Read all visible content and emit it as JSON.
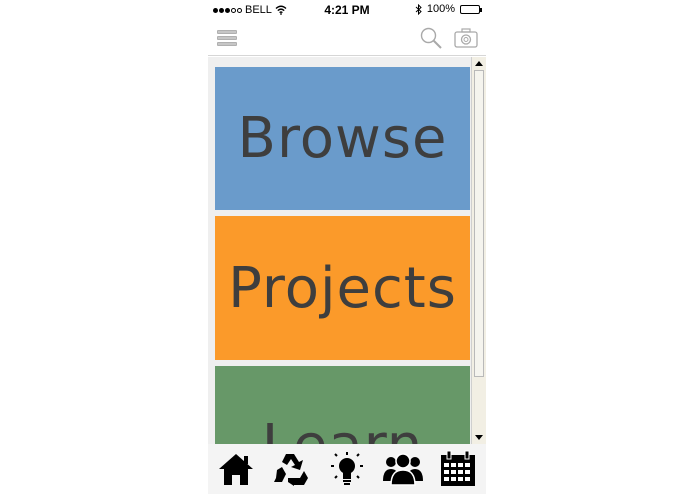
{
  "status_bar": {
    "carrier": "BELL",
    "time": "4:21 PM",
    "battery_percent": "100%",
    "battery_level": 1.0,
    "signal_filled": 3,
    "signal_total": 5
  },
  "toolbar": {
    "menu_icon": "hamburger-menu-icon",
    "search_icon": "search-icon",
    "camera_icon": "camera-icon"
  },
  "tiles": [
    {
      "label": "Browse",
      "color": "#6a9bcb"
    },
    {
      "label": "Projects",
      "color": "#fb9a2a"
    },
    {
      "label": "Learn",
      "color": "#679868"
    }
  ],
  "tabbar": {
    "items": [
      {
        "icon": "home-icon"
      },
      {
        "icon": "recycle-icon"
      },
      {
        "icon": "lightbulb-icon"
      },
      {
        "icon": "people-icon"
      },
      {
        "icon": "calendar-icon"
      }
    ]
  },
  "colors": {
    "text": "#3e3e3e",
    "background": "#efefef",
    "scrollbar": "#f2efe4"
  }
}
